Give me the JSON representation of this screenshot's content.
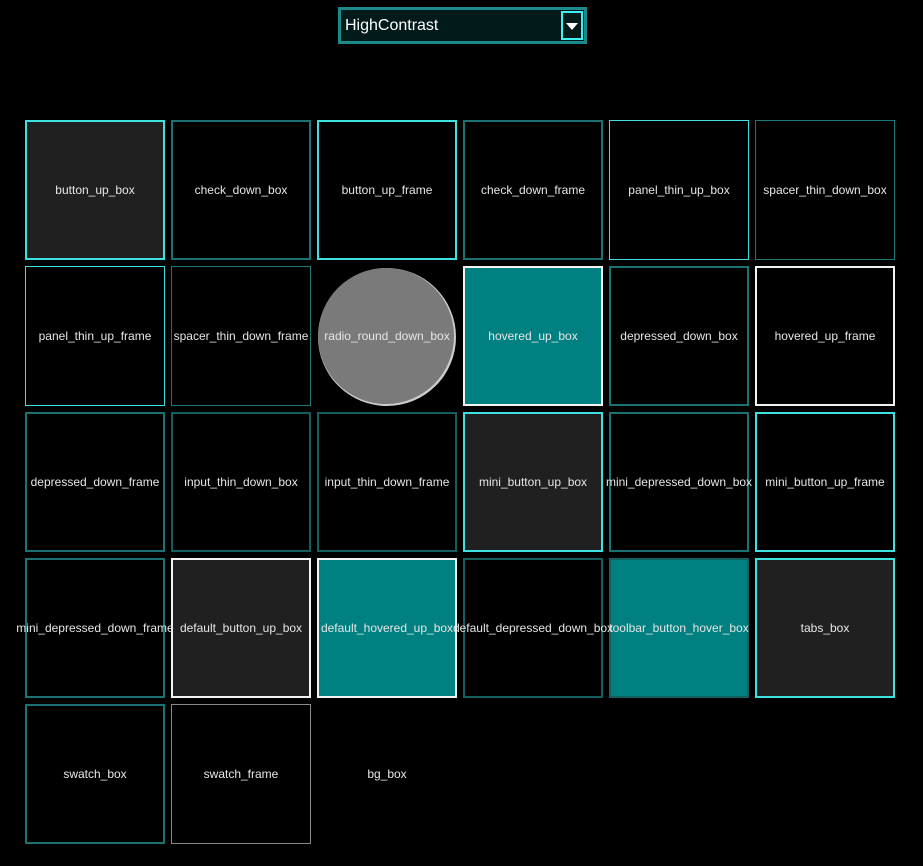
{
  "theme_select": {
    "selected_value": "HighContrast"
  },
  "icons": {
    "dropdown": "chevron-down-icon"
  },
  "colors": {
    "background": "#000000",
    "accent_cyan": "#3fe0e0",
    "teal_fill": "#008080",
    "dark_fill": "#202020",
    "radio_fill": "#7a7a7a"
  },
  "tiles": [
    {
      "label": "button_up_box"
    },
    {
      "label": "check_down_box"
    },
    {
      "label": "button_up_frame"
    },
    {
      "label": "check_down_frame"
    },
    {
      "label": "panel_thin_up_box"
    },
    {
      "label": "spacer_thin_down_box"
    },
    {
      "label": "panel_thin_up_frame"
    },
    {
      "label": "spacer_thin_down_frame"
    },
    {
      "label": "radio_round_down_box"
    },
    {
      "label": "hovered_up_box"
    },
    {
      "label": "depressed_down_box"
    },
    {
      "label": "hovered_up_frame"
    },
    {
      "label": "depressed_down_frame"
    },
    {
      "label": "input_thin_down_box"
    },
    {
      "label": "input_thin_down_frame"
    },
    {
      "label": "mini_button_up_box"
    },
    {
      "label": "mini_depressed_down_box"
    },
    {
      "label": "mini_button_up_frame"
    },
    {
      "label": "mini_depressed_down_frame"
    },
    {
      "label": "default_button_up_box"
    },
    {
      "label": "default_hovered_up_box"
    },
    {
      "label": "default_depressed_down_box"
    },
    {
      "label": "toolbar_button_hover_box"
    },
    {
      "label": "tabs_box"
    },
    {
      "label": "swatch_box"
    },
    {
      "label": "swatch_frame"
    },
    {
      "label": "bg_box"
    }
  ]
}
